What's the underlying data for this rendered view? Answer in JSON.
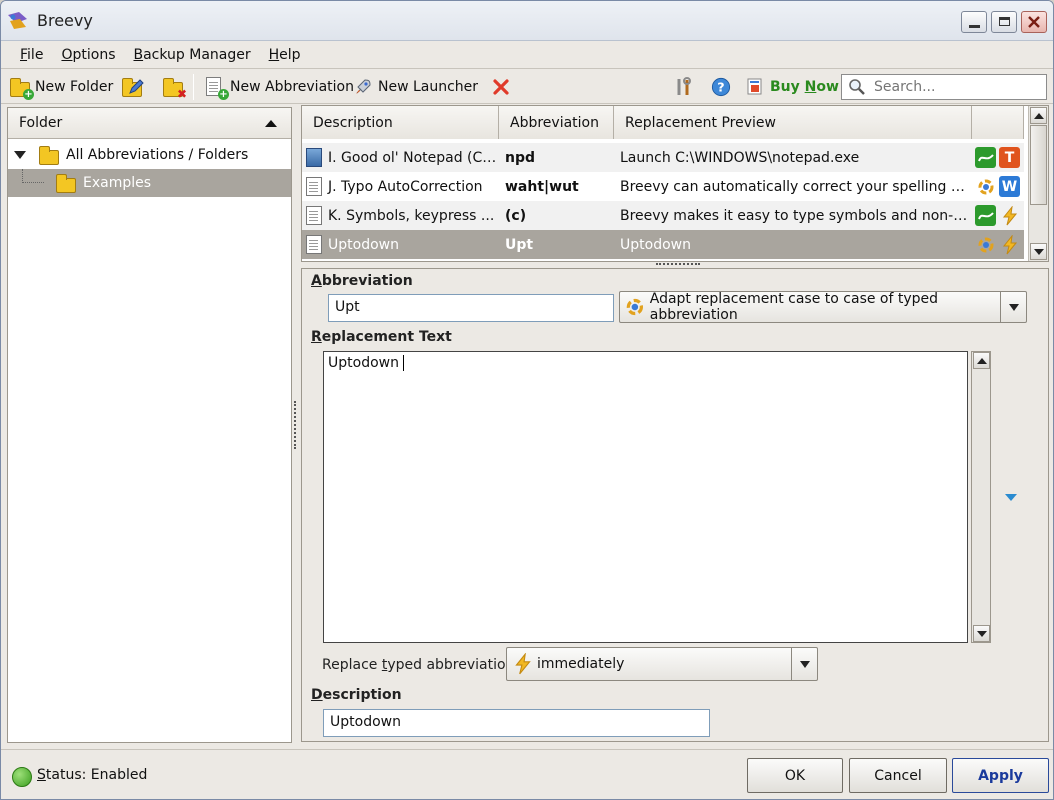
{
  "window": {
    "title": "Breevy"
  },
  "menu": [
    {
      "pre": "",
      "u": "F",
      "post": "ile"
    },
    {
      "pre": "",
      "u": "O",
      "post": "ptions"
    },
    {
      "pre": "",
      "u": "B",
      "post": "ackup Manager"
    },
    {
      "pre": "",
      "u": "H",
      "post": "elp"
    }
  ],
  "toolbar": {
    "new_folder": "New Folder",
    "new_abbreviation": "New Abbreviation",
    "new_launcher": "New Launcher",
    "buy_now_pre": "Buy ",
    "buy_now_u": "N",
    "buy_now_post": "ow",
    "search_placeholder": "Search..."
  },
  "folders": {
    "header": "Folder",
    "items": [
      {
        "label": "All Abbreviations / Folders"
      },
      {
        "label": "Examples"
      }
    ]
  },
  "grid": {
    "columns": [
      "Description",
      "Abbreviation",
      "Replacement Preview",
      ""
    ],
    "rows": [
      {
        "description": "I. Good ol' Notepad (Ch...",
        "abbreviation": "npd",
        "preview": "Launch C:\\WINDOWS\\notepad.exe",
        "icons": [
          "graph-icon",
          "t-icon"
        ]
      },
      {
        "description": "J. Typo AutoCorrection",
        "abbreviation": "waht|wut",
        "preview": "Breevy can automatically correct your spelling error...",
        "icons": [
          "adapt-case-icon",
          "w-icon"
        ]
      },
      {
        "description": "K. Symbols, keypress ...",
        "abbreviation": "(c)",
        "preview": "Breevy makes it easy to type symbols and non-Engli...",
        "icons": [
          "graph-icon",
          "lightning-icon"
        ]
      },
      {
        "description": "Uptodown",
        "abbreviation": "Upt",
        "preview": "Uptodown",
        "icons": [
          "adapt-case-icon",
          "lightning-icon"
        ]
      }
    ]
  },
  "detail": {
    "abbreviation_label_u": "A",
    "abbreviation_label_rest": "bbreviation",
    "abbreviation_value": "Upt",
    "case_option": "Adapt replacement case to case of typed abbreviation",
    "replacement_label_u": "R",
    "replacement_label_rest": "eplacement Text",
    "replacement_value": "Uptodown",
    "replace_label_pre": "Replace ",
    "replace_label_u": "t",
    "replace_label_post": "yped abbreviation:",
    "replace_option": "immediately",
    "description_label_u": "D",
    "description_label_rest": "escription",
    "description_value": "Uptodown"
  },
  "status": {
    "pre": "",
    "u": "S",
    "post": "tatus: Enabled"
  },
  "buttons": {
    "ok": "OK",
    "cancel": "Cancel",
    "apply": "Apply"
  },
  "colors": {
    "selection": "#a9a59e",
    "buy_now": "#2a8a1e",
    "status_green": "#3a9e1e",
    "apply_text": "#1a3a9c"
  }
}
